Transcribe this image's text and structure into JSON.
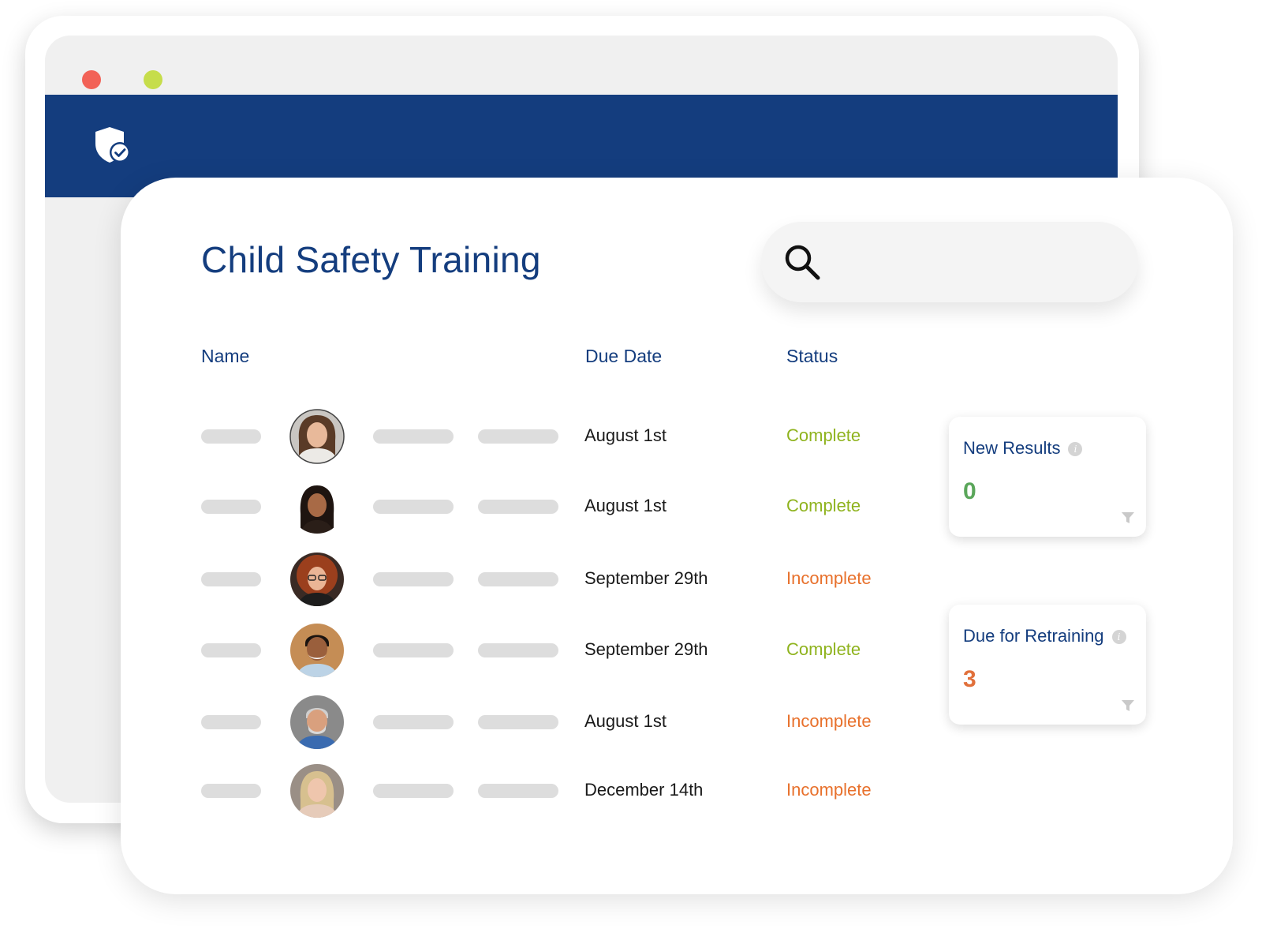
{
  "colors": {
    "brand_blue": "#143d7e",
    "complete": "#8fb31e",
    "incomplete": "#e8712c",
    "new_results_value": "#5aa65a",
    "retraining_value": "#e1703b",
    "window_dot_red": "#f26257",
    "window_dot_green": "#c6dd4b"
  },
  "header": {
    "logo_icon": "shield-check-icon"
  },
  "page": {
    "title": "Child Safety Training"
  },
  "search": {
    "icon": "search-icon",
    "value": "",
    "placeholder": ""
  },
  "table": {
    "headers": {
      "name": "Name",
      "due_date": "Due Date",
      "status": "Status"
    },
    "rows": [
      {
        "due_date": "August 1st",
        "status": "Complete"
      },
      {
        "due_date": "August 1st",
        "status": "Complete"
      },
      {
        "due_date": "September 29th",
        "status": "Incomplete"
      },
      {
        "due_date": "September 29th",
        "status": "Complete"
      },
      {
        "due_date": "August 1st",
        "status": "Incomplete"
      },
      {
        "due_date": "December 14th",
        "status": "Incomplete"
      }
    ]
  },
  "stats": {
    "new_results": {
      "title": "New Results",
      "value": "0"
    },
    "due_for_retraining": {
      "title": "Due for Retraining",
      "value": "3"
    }
  }
}
